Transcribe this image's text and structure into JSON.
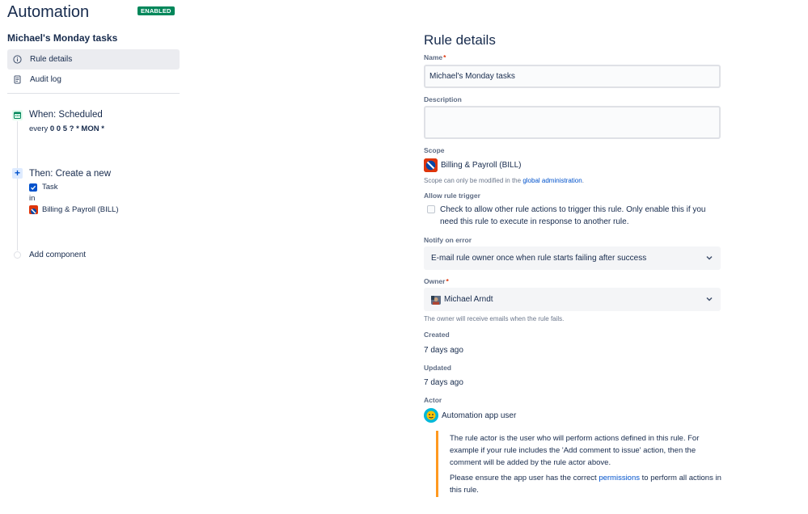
{
  "app": {
    "title": "Automation",
    "status_badge": "ENABLED",
    "rule_name": "Michael's Monday tasks"
  },
  "nav": {
    "items": [
      {
        "label": "Rule details",
        "icon": "info-icon",
        "active": true
      },
      {
        "label": "Audit log",
        "icon": "document-icon",
        "active": false
      }
    ]
  },
  "components": {
    "trigger": {
      "title": "When: Scheduled",
      "schedule_prefix": "every ",
      "schedule_cron": "0 0 5 ? * MON *",
      "icon": "calendar-icon"
    },
    "action": {
      "title": "Then: Create a new",
      "issue_type": "Task",
      "in_label": "in",
      "project": "Billing & Payroll (BILL)",
      "icon": "plus-icon"
    },
    "add_component_label": "Add component"
  },
  "details": {
    "title": "Rule details",
    "name": {
      "label": "Name",
      "value": "Michael's Monday tasks"
    },
    "description": {
      "label": "Description",
      "value": ""
    },
    "scope": {
      "label": "Scope",
      "project": "Billing & Payroll (BILL)",
      "help_prefix": "Scope can only be modified in the ",
      "help_link": "global administration",
      "help_suffix": "."
    },
    "allow_trigger": {
      "label": "Allow rule trigger",
      "checkbox_text": "Check to allow other rule actions to trigger this rule. Only enable this if you need this rule to execute in response to another rule.",
      "checked": false
    },
    "notify": {
      "label": "Notify on error",
      "value": "E-mail rule owner once when rule starts failing after success"
    },
    "owner": {
      "label": "Owner",
      "value": "Michael Arndt",
      "help": "The owner will receive emails when the rule fails."
    },
    "created": {
      "label": "Created",
      "value": "7 days ago"
    },
    "updated": {
      "label": "Updated",
      "value": "7 days ago"
    },
    "actor": {
      "label": "Actor",
      "value": "Automation app user",
      "note_1": "The rule actor is the user who will perform actions defined in this rule. For example if your rule includes the 'Add comment to issue' action, then the comment will be added by the rule actor above.",
      "note_2_prefix": "Please ensure the app user has the correct ",
      "note_2_link": "permissions",
      "note_2_suffix": " to perform all actions in this rule."
    }
  },
  "colors": {
    "badge_green": "#00875a",
    "link_blue": "#0052cc",
    "note_orange": "#ff991f",
    "project_red": "#de350b",
    "required_red": "#de350b"
  }
}
